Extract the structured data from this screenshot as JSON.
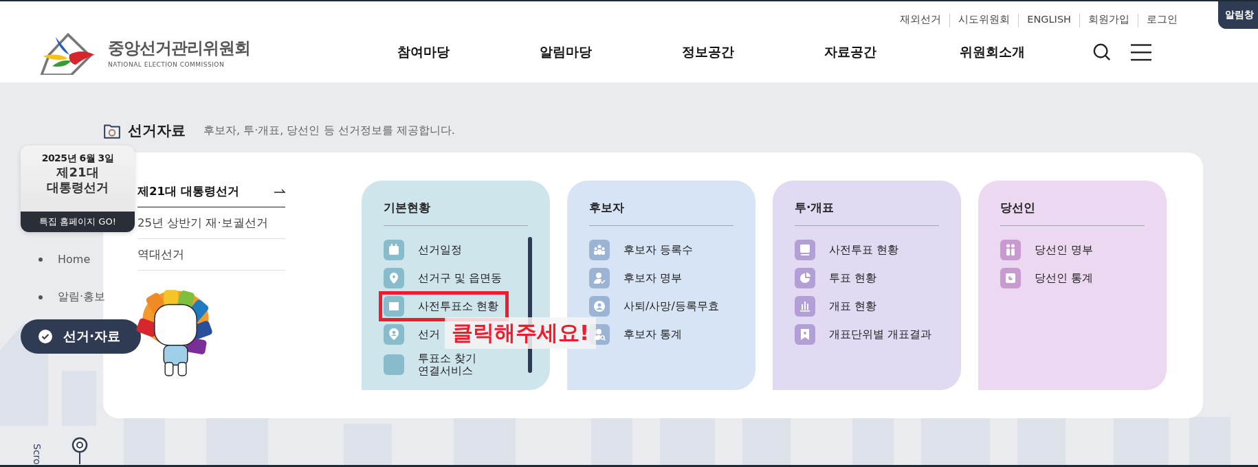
{
  "utility_links": [
    "재외선거",
    "시도위원회",
    "ENGLISH",
    "회원가입",
    "로그인"
  ],
  "notice_tab": "알림창",
  "logo": {
    "name": "중앙선거관리위원회",
    "subtitle": "NATIONAL ELECTION COMMISSION"
  },
  "nav": [
    "참여마당",
    "알림마당",
    "정보공간",
    "자료공간",
    "위원회소개"
  ],
  "section": {
    "title": "선거자료",
    "description": "후보자, 투·개표, 당선인 등 선거정보를 제공합니다."
  },
  "promo": {
    "date": "2025년 6월 3일",
    "lines": [
      "제21대",
      "대통령선거"
    ],
    "cta": "특집 홈페이지 GO!"
  },
  "side_menu": [
    {
      "label": "Home",
      "selected": false
    },
    {
      "label": "알림·홍보",
      "selected": false
    },
    {
      "label": "선거·자료",
      "selected": true
    }
  ],
  "elections": [
    {
      "label": "제21대 대통령선거",
      "selected": true
    },
    {
      "label": "25년 상반기 재·보궐선거",
      "selected": false
    },
    {
      "label": "역대선거",
      "selected": false
    }
  ],
  "cards": [
    {
      "title": "기본현황",
      "color": "#cfe5ec",
      "scrollable": true,
      "items": [
        {
          "label": "선거일정",
          "highlighted": false
        },
        {
          "label": "선거구 및 읍면동",
          "highlighted": false
        },
        {
          "label": "사전투표소 현황",
          "highlighted": true
        },
        {
          "label": "선거",
          "highlighted": false
        },
        {
          "label": "투표소 찾기 연결서비스",
          "highlighted": false
        }
      ]
    },
    {
      "title": "후보자",
      "color": "#d7e4f5",
      "items": [
        {
          "label": "후보자 등록수",
          "highlighted": false
        },
        {
          "label": "후보자 명부",
          "highlighted": false
        },
        {
          "label": "사퇴/사망/등록무효",
          "highlighted": false
        },
        {
          "label": "후보자 통계",
          "highlighted": false
        }
      ]
    },
    {
      "title": "투·개표",
      "color": "#e1daf2",
      "items": [
        {
          "label": "사전투표 현황",
          "highlighted": false
        },
        {
          "label": "투표 현황",
          "highlighted": false
        },
        {
          "label": "개표 현황",
          "highlighted": false
        },
        {
          "label": "개표단위별 개표결과",
          "highlighted": false
        }
      ]
    },
    {
      "title": "당선인",
      "color": "#ecd8f0",
      "items": [
        {
          "label": "당선인 명부",
          "highlighted": false
        },
        {
          "label": "당선인 통계",
          "highlighted": false
        }
      ]
    }
  ],
  "annotation": "클릭해주세요!",
  "scroll_hint": "Scro"
}
